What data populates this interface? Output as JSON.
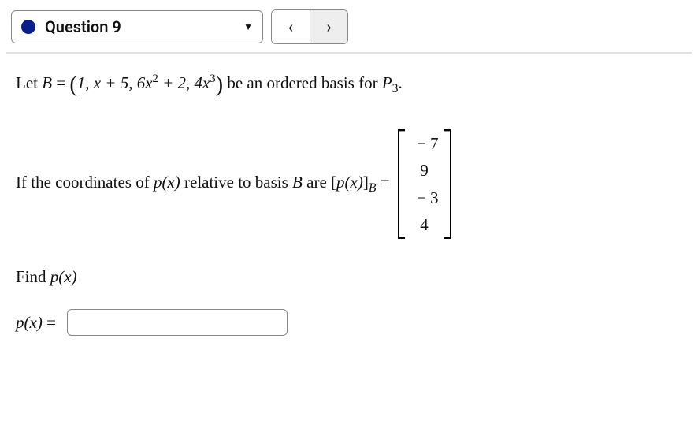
{
  "toolbar": {
    "question_label": "Question 9",
    "prev_symbol": "‹",
    "next_symbol": "›"
  },
  "problem": {
    "let_prefix": "Let ",
    "B": "B",
    "equals": " = ",
    "basis_open": "(",
    "basis_terms": "1, x + 5, 6x",
    "sq": "2",
    "plus2": " + 2, 4x",
    "cube": "3",
    "basis_close": ")",
    "let_suffix": " be an ordered basis for ",
    "P": "P",
    "P_sub": "3",
    "period": ".",
    "coords_prefix": "If the coordinates of ",
    "p_of_x": "p(x)",
    "coords_mid": " relative to basis ",
    "coords_mid2": " are ",
    "bracket_open": "[",
    "bracket_close": "]",
    "sub_B": "B",
    "vector": [
      "− 7",
      "9",
      "− 3",
      "4"
    ],
    "find_label": "Find ",
    "answer_label": "p(x) = "
  }
}
